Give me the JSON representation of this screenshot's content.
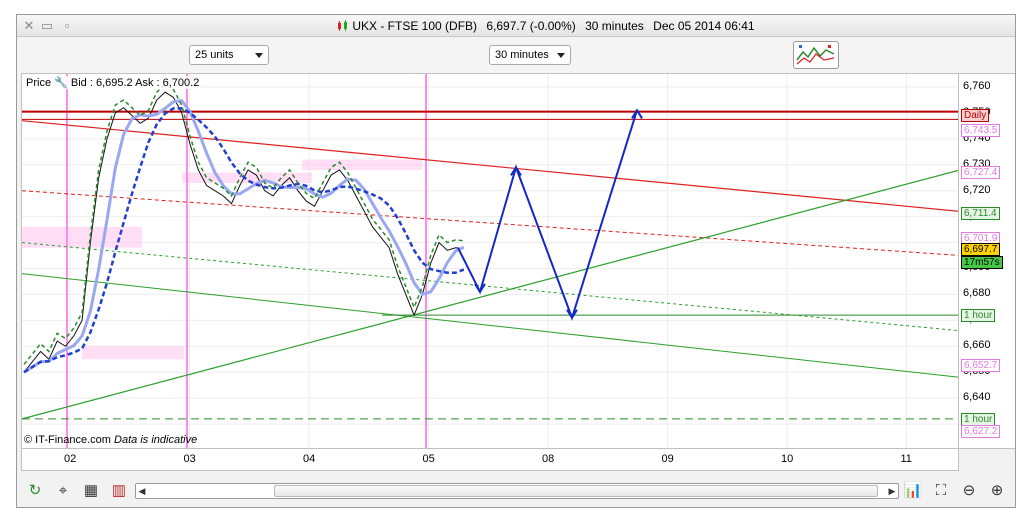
{
  "window": {
    "title_symbol": "UKX - FTSE 100 (DFB)",
    "title_price": "6,697.7 (-0.00%)",
    "title_interval": "30 minutes",
    "title_datetime": "Dec 05 2014 06:41"
  },
  "toolbar": {
    "units_select": "25 units",
    "interval_select": "30 minutes"
  },
  "chart": {
    "price_label": "Price",
    "bid_ask": "Bid : 6,695.2 Ask : 6,700.2",
    "footer_source": "© IT-Finance.com",
    "footer_note": "Data is indicative"
  },
  "chart_data": {
    "type": "line",
    "ylim": [
      6620,
      6765
    ],
    "y_ticks": [
      "6,760",
      "6,750",
      "6,740",
      "6,730",
      "6,720",
      "6,710",
      "6,700",
      "6,690",
      "6,680",
      "6,670",
      "6,660",
      "6,650",
      "6,640",
      "6,630"
    ],
    "x_ticks": [
      "02",
      "03",
      "04",
      "05",
      "08",
      "09",
      "10",
      "11"
    ],
    "price_tags": [
      {
        "label": "Daily",
        "value": 6749,
        "color": "#c00000",
        "bg": "#f6d0d0"
      },
      {
        "label": "6,743.5",
        "value": 6743.5,
        "color": "#e37ae3",
        "bg": "#ffffff"
      },
      {
        "label": "6,727.4",
        "value": 6727.4,
        "color": "#e37ae3",
        "bg": "#ffffff"
      },
      {
        "label": "6,711.4",
        "value": 6711.4,
        "color": "#2a8a2a",
        "bg": "#e6f4e6"
      },
      {
        "label": "6,701.9",
        "value": 6701.9,
        "color": "#e37ae3",
        "bg": "#ffffff"
      },
      {
        "label": "6,697.7",
        "value": 6697.7,
        "color": "#000000",
        "bg": "#ffd200"
      },
      {
        "label": "17m57s",
        "value": 6692.5,
        "color": "#000000",
        "bg": "#46c846"
      },
      {
        "label": "1 hour",
        "value": 6672,
        "color": "#2a8a2a",
        "bg": "#e6f4e6"
      },
      {
        "label": "6,652.7",
        "value": 6652.7,
        "color": "#e37ae3",
        "bg": "#ffffff"
      },
      {
        "label": "1 hour",
        "value": 6632,
        "color": "#2a8a2a",
        "bg": "#e6f4e6"
      },
      {
        "label": "6,627.2",
        "value": 6627.2,
        "color": "#e37ae3",
        "bg": "#ffffff"
      }
    ],
    "price_series": {
      "x": [
        0,
        2,
        4,
        6,
        8,
        10,
        12,
        14,
        16,
        18,
        20,
        22,
        24,
        26,
        28,
        30,
        32,
        34,
        36,
        38,
        40,
        42,
        44,
        46,
        48,
        50,
        52,
        54,
        56,
        58,
        60,
        62,
        64,
        66,
        68,
        70,
        72,
        74,
        76,
        78,
        80,
        82,
        84,
        86,
        88,
        90,
        92,
        94,
        96,
        98,
        100,
        102,
        104,
        106
      ],
      "y": [
        6650,
        6654,
        6658,
        6655,
        6662,
        6660,
        6664,
        6670,
        6700,
        6725,
        6740,
        6750,
        6752,
        6749,
        6746,
        6748,
        6755,
        6758,
        6756,
        6750,
        6738,
        6728,
        6722,
        6720,
        6718,
        6715,
        6722,
        6728,
        6726,
        6720,
        6718,
        6722,
        6725,
        6720,
        6716,
        6714,
        6720,
        6726,
        6728,
        6724,
        6718,
        6712,
        6706,
        6702,
        6698,
        6688,
        6680,
        6672,
        6680,
        6692,
        6700,
        6697,
        6698,
        6697.7
      ]
    }
  }
}
